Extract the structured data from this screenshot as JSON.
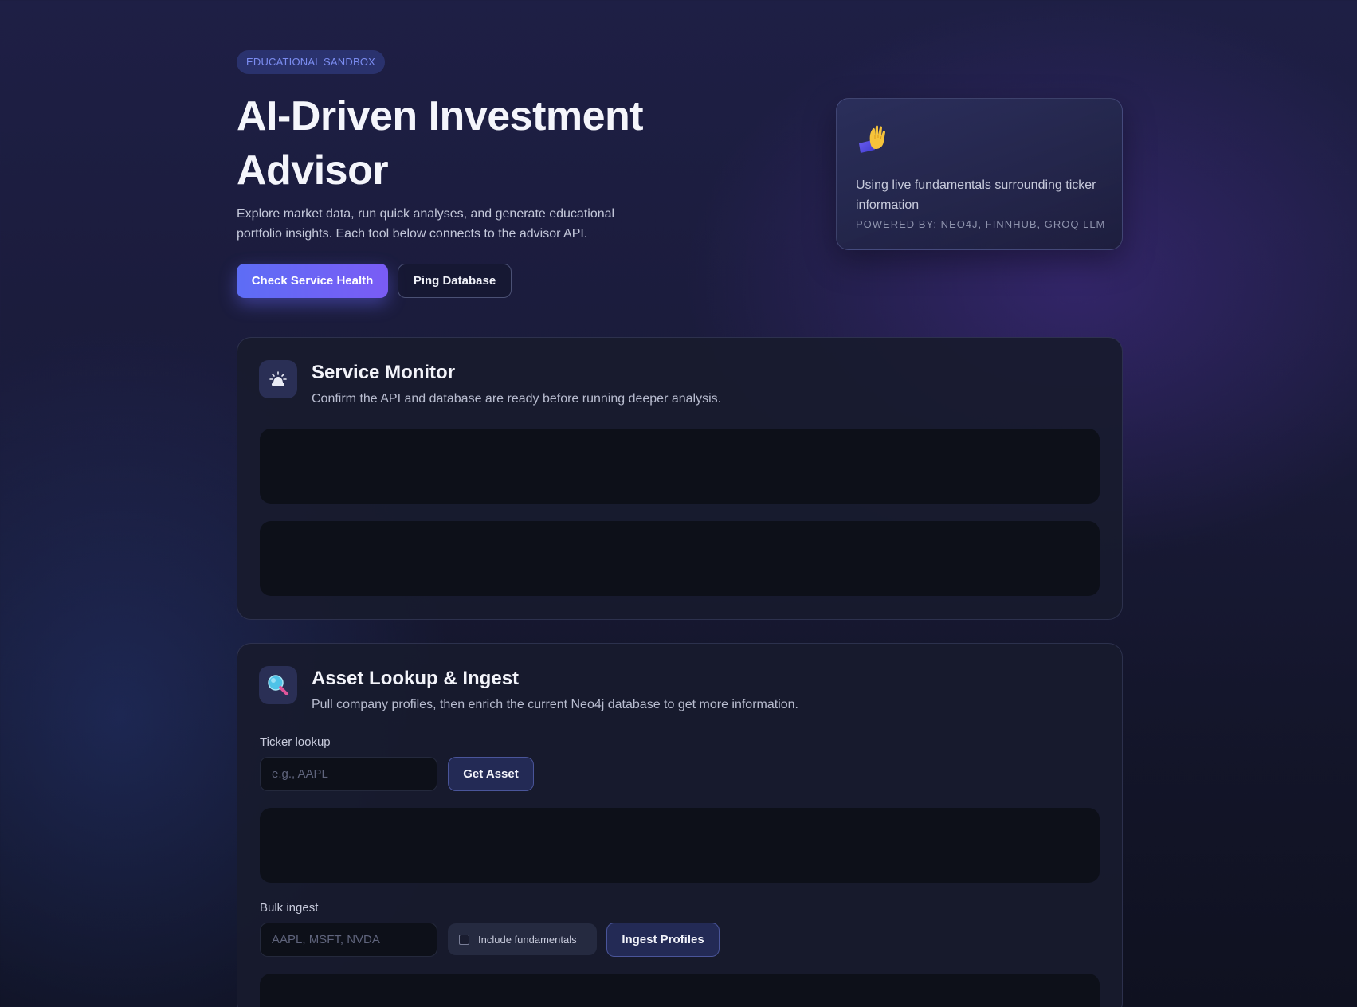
{
  "hero": {
    "badge": "EDUCATIONAL SANDBOX",
    "title": "AI-Driven Investment Advisor",
    "subtitle": "Explore market data, run quick analyses, and generate educational portfolio insights. Each tool below connects to the advisor API.",
    "primary_button": "Check Service Health",
    "secondary_button": "Ping Database"
  },
  "info_card": {
    "icon": "raised-hand-icon",
    "text": "Using live fundamentals surrounding ticker information",
    "powered_by": "POWERED BY: NEO4J, FINNHUB, GROQ LLM"
  },
  "service_monitor": {
    "icon": "alarm-light-icon",
    "title": "Service Monitor",
    "description": "Confirm the API and database are ready before running deeper analysis."
  },
  "asset_lookup": {
    "icon": "magnifier-icon",
    "title": "Asset Lookup & Ingest",
    "description": "Pull company profiles, then enrich the current Neo4j database to get more information.",
    "ticker_label": "Ticker lookup",
    "ticker_placeholder": "e.g., AAPL",
    "ticker_value": "",
    "get_asset_button": "Get Asset",
    "bulk_label": "Bulk ingest",
    "bulk_placeholder": "AAPL, MSFT, NVDA",
    "bulk_value": "",
    "include_fundamentals_label": "Include fundamentals",
    "include_fundamentals_checked": false,
    "ingest_button": "Ingest Profiles"
  },
  "colors": {
    "accent": "#5d6df5",
    "accent_secondary": "#7a5cf5",
    "panel_bg": "#181b2e",
    "output_bg": "#0d1019",
    "badge_text": "#7b8cf0"
  }
}
